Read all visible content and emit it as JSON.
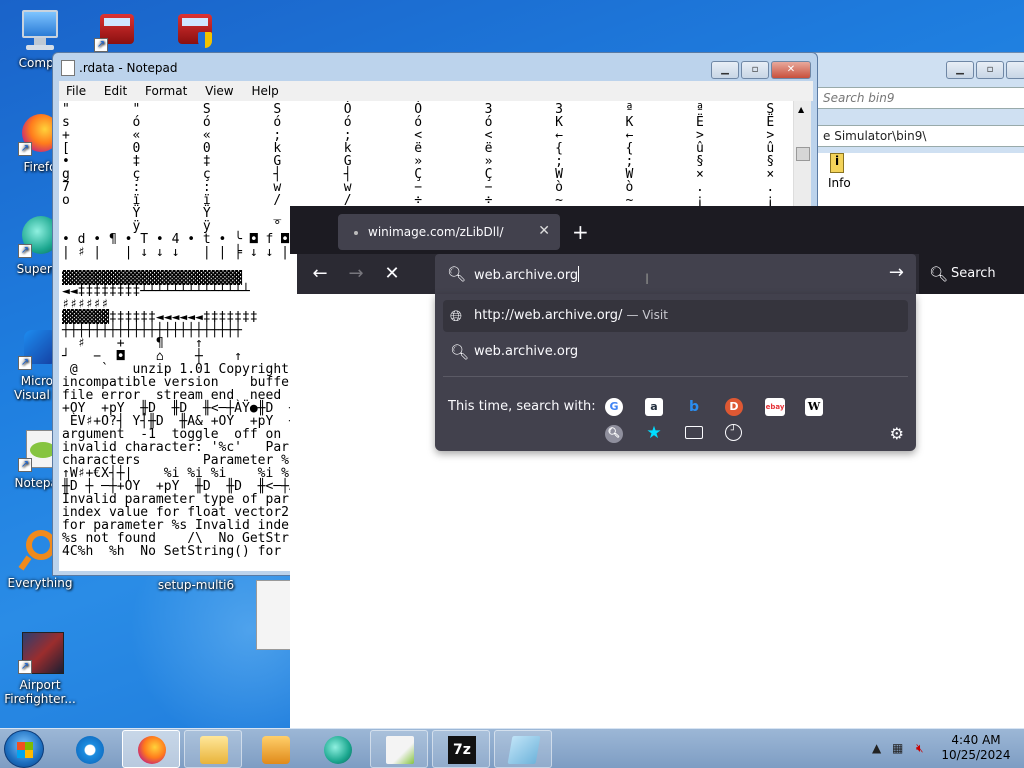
{
  "desktop": {
    "icons": [
      {
        "label": "Compu",
        "icon": "computer-icon"
      },
      {
        "label": "",
        "icon": "firetruck-icon"
      },
      {
        "label": "",
        "icon": "firetruck-shield-icon"
      },
      {
        "label": "Firefo",
        "icon": "firefox-icon"
      },
      {
        "label": "Superm",
        "icon": "supermium-icon"
      },
      {
        "label": "Micros\nVisual St",
        "icon": "visual-studio-icon"
      },
      {
        "label": "Notepad",
        "icon": "notepad-plus-icon"
      },
      {
        "label": "Everything",
        "icon": "everything-icon"
      },
      {
        "label": "setup-multi6",
        "icon": "setup-icon"
      },
      {
        "label": "Airport\nFirefighter...",
        "icon": "airport-firefighter-icon"
      }
    ]
  },
  "explorer": {
    "search_placeholder": "Search bin9",
    "path": "e Simulator\\bin9\\",
    "info_label": "Info"
  },
  "notepad": {
    "title": ".rdata - Notepad",
    "menu": [
      "File",
      "Edit",
      "Format",
      "View",
      "Help"
    ],
    "content": "\"        \"        S        S        Ó        Ó        3        3        ª        ª        S\ns        ó        ó        ó        ó        ó        ó        K        K        Ë        Ë        +\n+        «        «        ;        ;        <        <        ←        ←        >        >        [\n[        0        0        k        k        ë        ë        {        {        û        û        ●\n•        ‡        ‡        G        G        »        »        ;        ;        §        §        g\ng        ç        ç        ┤        ┤        Ç        Ç        W        W        ×        ×        7\n7        :        :        w        w        −        −        ò        ò        .        .        o\no        ï        ï        /        /        ÷        ÷        ~        ~        ¡        ¡\n         Ÿ        Ÿ        _\n         ÿ        ÿ        °\n• d • ¶ • T • 4 • t • ╰ ◘ f ◘ C ◘\n| ♯ |   | ↓ ↓ ↓   | | ╞ ↓ ↓ | ┼\n\n▓▓▓▓▓▓▓▓▓▓▓▓▓▓▓▓▓▓▓▓▓▓▓\n◄◄‡‡‡‡‡‡‡‡┴┴┴┴┴┴┴┴┴┴┴┴┴┴\n♯♯♯♯♯♯\n▓▓▓▓▓▓‡‡‡‡‡‡◄◄◄◄◄◄‡‡‡‡‡‡‡\n┼┼┼┼┼┼┼┼┼┼┼┼┼┼┼┼┼┼┼┼┼┼┼\n  ♯    +    ¶    ↑           (   0\n┘   −  ◘    ⌂    ┼    ↑        0\n @   `   unzip 1.01 Copyright\nincompatible version    buffe\nfile error  stream end  need\n+OY  +pY  ╫D  ╫D  ╫<─┼ÀŸ●╫D  ╫P6┤ 1\n ÈV♯+O?┤ Y┤╫D  ╫A& +OY  +pY  ╫D\nargument  -1  toggle  off on\ninvalid character: '%c'   Par\ncharacters        Parameter %\n↑W♯+€X┤┼|    %i %i %i    %i %i %\n╫D ┼ ─┼+OY  +pY  ╫D  ╫D  ╫<─┼ÀŸ●╫D\nInvalid parameter type of par\nindex value for float vector2\nfor parameter %s Invalid inde\n%s not found    /\\  No GetStr\n4C%h  %h  No SetString() for"
  },
  "firefox": {
    "tab_title": "winimage.com/zLibDll/",
    "url_text": "web.archive.org",
    "search_label": "Search",
    "suggestions": [
      {
        "text": "http://web.archive.org/",
        "suffix": " — Visit",
        "icon": "globe-icon"
      },
      {
        "text": "web.archive.org",
        "suffix": "",
        "icon": "search-icon"
      }
    ],
    "search_with_label": "This time, search with:",
    "engines": [
      {
        "name": "google-engine-icon",
        "glyph": "G",
        "color": "#4285f4"
      },
      {
        "name": "amazon-engine-icon",
        "glyph": "a",
        "color": "#232f3e"
      },
      {
        "name": "bing-engine-icon",
        "glyph": "b",
        "color": "#0078d4"
      },
      {
        "name": "duckduckgo-engine-icon",
        "glyph": "D",
        "color": "#de5833"
      },
      {
        "name": "ebay-engine-icon",
        "glyph": "ebay",
        "color": "#e53238"
      },
      {
        "name": "wikipedia-engine-icon",
        "glyph": "W",
        "color": "#ffffff"
      }
    ]
  },
  "taskbar": {
    "clock_time": "4:40 AM",
    "clock_date": "10/25/2024"
  }
}
